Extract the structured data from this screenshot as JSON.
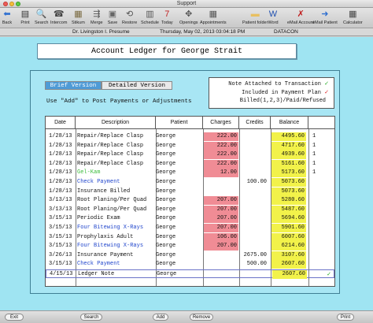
{
  "window": {
    "title": "Support"
  },
  "toolbar": [
    {
      "label": "Back",
      "icon": "back-arrow-icon",
      "glyph": "⬅",
      "color": "#2f6fd0"
    },
    {
      "label": "Print",
      "icon": "print-icon",
      "glyph": "▤",
      "color": "#333333"
    },
    {
      "label": "Search",
      "icon": "search-icon",
      "glyph": "🔍",
      "color": "#333333"
    },
    {
      "label": "Intercom",
      "icon": "intercom-icon",
      "glyph": "☎",
      "color": "#444444"
    },
    {
      "label": "Stikum",
      "icon": "sticky-note-icon",
      "glyph": "▦",
      "color": "#7a6a40"
    },
    {
      "label": "Merge",
      "icon": "merge-icon",
      "glyph": "⇶",
      "color": "#555555"
    },
    {
      "label": "Save",
      "icon": "save-icon",
      "glyph": "▣",
      "color": "#666666"
    },
    {
      "label": "Restore",
      "icon": "restore-icon",
      "glyph": "⟲",
      "color": "#555555"
    },
    {
      "label": "Schedule",
      "icon": "schedule-icon",
      "glyph": "▥",
      "color": "#555555"
    },
    {
      "label": "Today",
      "icon": "calendar-today-icon",
      "glyph": "7",
      "color": "#c02020"
    },
    {
      "label": "Openings",
      "icon": "openings-icon",
      "glyph": "✥",
      "color": "#555555"
    },
    {
      "label": "Appointments",
      "icon": "appointments-icon",
      "glyph": "▦",
      "color": "#555555"
    },
    {
      "label": "Patient folder",
      "icon": "patient-folder-icon",
      "glyph": "▬",
      "color": "#e8c060"
    },
    {
      "label": "Word",
      "icon": "word-icon",
      "glyph": "W",
      "color": "#2050b0"
    },
    {
      "label": "eMail Account",
      "icon": "email-account-icon",
      "glyph": "✗",
      "color": "#c02020"
    },
    {
      "label": "eMail Patient",
      "icon": "email-patient-icon",
      "glyph": "➜",
      "color": "#2f6fd0"
    },
    {
      "label": "Calculator",
      "icon": "calculator-icon",
      "glyph": "▦",
      "color": "#444444"
    }
  ],
  "infobar": {
    "doctor": "Dr. Livingston I. Presume",
    "datetime": "Thursday, May 02, 2013   03:04:18 PM",
    "database": "DATACON"
  },
  "page": {
    "title": "Account Ledger for George Strait",
    "tab_brief": "Brief Version",
    "tab_detailed": "Detailed Version",
    "hint": "Use \"Add\" to Post Payments or Adjustments"
  },
  "legend": {
    "line1": "Note Attached to Transaction",
    "line2": "Included in Payment Plan",
    "line3": "Billed(1,2,3)/Paid/Refused",
    "check": "✓"
  },
  "table": {
    "headers": {
      "date": "Date",
      "description": "Description",
      "patient": "Patient",
      "charges": "Charges",
      "credits": "Credits",
      "balance": "Balance"
    },
    "rows": [
      {
        "date": "1/28/13",
        "description": "Repair/Replace Clasp",
        "patient": "George",
        "charges": "222.00",
        "credits": "",
        "balance": "4495.60",
        "flag": "1",
        "style": ""
      },
      {
        "date": "1/28/13",
        "description": "Repair/Replace Clasp",
        "patient": "George",
        "charges": "222.00",
        "credits": "",
        "balance": "4717.60",
        "flag": "1",
        "style": ""
      },
      {
        "date": "1/28/13",
        "description": "Repair/Replace Clasp",
        "patient": "George",
        "charges": "222.00",
        "credits": "",
        "balance": "4939.60",
        "flag": "1",
        "style": ""
      },
      {
        "date": "1/28/13",
        "description": "Repair/Replace Clasp",
        "patient": "George",
        "charges": "222.00",
        "credits": "",
        "balance": "5161.60",
        "flag": "1",
        "style": ""
      },
      {
        "date": "1/28/13",
        "description": "Gel-Kam",
        "patient": "George",
        "charges": "12.00",
        "credits": "",
        "balance": "5173.60",
        "flag": "1",
        "style": "green"
      },
      {
        "date": "1/28/13",
        "description": "Check Payment",
        "patient": "George",
        "charges": "",
        "credits": "100.00",
        "balance": "5073.60",
        "flag": "",
        "style": "blue"
      },
      {
        "date": "1/28/13",
        "description": "Insurance Billed",
        "patient": "George",
        "charges": "",
        "credits": "",
        "balance": "5073.60",
        "flag": "",
        "style": ""
      },
      {
        "date": "3/13/13",
        "description": "Root Planing/Per Quad",
        "patient": "George",
        "charges": "207.00",
        "credits": "",
        "balance": "5280.60",
        "flag": "",
        "style": ""
      },
      {
        "date": "3/13/13",
        "description": "Root Planing/Per Quad",
        "patient": "George",
        "charges": "207.00",
        "credits": "",
        "balance": "5487.60",
        "flag": "",
        "style": ""
      },
      {
        "date": "3/15/13",
        "description": "Periodic Exam",
        "patient": "George",
        "charges": "207.00",
        "credits": "",
        "balance": "5694.60",
        "flag": "",
        "style": ""
      },
      {
        "date": "3/15/13",
        "description": "Four Bitewing X-Rays",
        "patient": "George",
        "charges": "207.00",
        "credits": "",
        "balance": "5901.60",
        "flag": "",
        "style": "blue"
      },
      {
        "date": "3/15/13",
        "description": "Prophylaxis Adult",
        "patient": "George",
        "charges": "106.00",
        "credits": "",
        "balance": "6007.60",
        "flag": "",
        "style": ""
      },
      {
        "date": "3/15/13",
        "description": "Four Bitewing X-Rays",
        "patient": "George",
        "charges": "207.00",
        "credits": "",
        "balance": "6214.60",
        "flag": "",
        "style": "blue"
      },
      {
        "date": "3/26/13",
        "description": "Insurance Payment",
        "patient": "George",
        "charges": "",
        "credits": "2675.00",
        "balance": "3107.60",
        "flag": "",
        "style": ""
      },
      {
        "date": "3/15/13",
        "description": "Check Payment",
        "patient": "George",
        "charges": "",
        "credits": "500.00",
        "balance": "2607.60",
        "flag": "",
        "style": "blue"
      },
      {
        "date": "4/15/13",
        "description": "Ledger Note",
        "patient": "George",
        "charges": "",
        "credits": "",
        "balance": "2607.60",
        "flag": "✓",
        "style": "note"
      }
    ]
  },
  "bottom_buttons": {
    "exit": "Exit",
    "search": "Search",
    "add": "Add",
    "remove": "Remove",
    "print": "Print"
  },
  "colors": {
    "background": "#9fe4f2",
    "charge_highlight": "#f08c95",
    "balance_highlight": "#f2f24a",
    "tab_active": "#4f9bd6",
    "payment_text": "#2146cc",
    "gel_kam_text": "#3cbc3c"
  }
}
